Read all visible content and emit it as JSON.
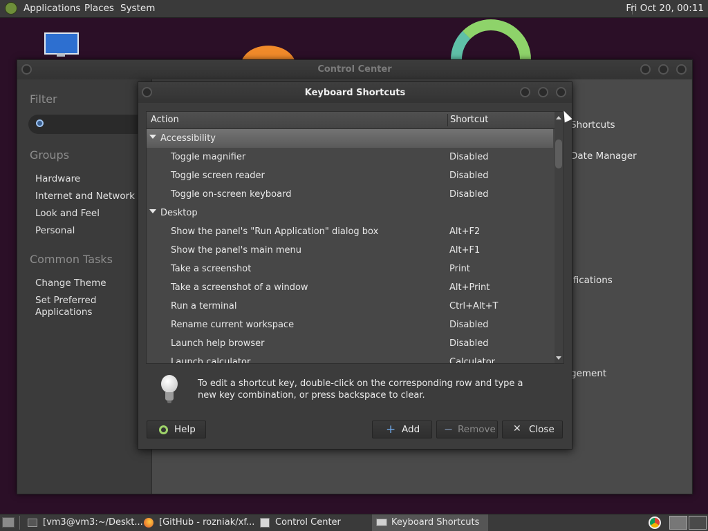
{
  "top_panel": {
    "menus": [
      "Applications",
      "Places",
      "System"
    ],
    "clock": "Fri Oct 20, 00:11"
  },
  "control_center": {
    "title": "Control Center",
    "filter_heading": "Filter",
    "groups_heading": "Groups",
    "groups": [
      "Hardware",
      "Internet and Network",
      "Look and Feel",
      "Personal"
    ],
    "tasks_heading": "Common Tasks",
    "tasks": [
      "Change Theme",
      "Set Preferred\nApplications"
    ],
    "peek_items": [
      "Shortcuts",
      "Date Manager",
      "ifications",
      "gement"
    ]
  },
  "dialog": {
    "title": "Keyboard Shortcuts",
    "columns": {
      "action": "Action",
      "shortcut": "Shortcut"
    },
    "rows": [
      {
        "type": "category",
        "action": "Accessibility",
        "shortcut": "",
        "selected": true
      },
      {
        "type": "item",
        "action": "Toggle magnifier",
        "shortcut": "Disabled"
      },
      {
        "type": "item",
        "action": "Toggle screen reader",
        "shortcut": "Disabled"
      },
      {
        "type": "item",
        "action": "Toggle on-screen keyboard",
        "shortcut": "Disabled"
      },
      {
        "type": "category",
        "action": "Desktop",
        "shortcut": ""
      },
      {
        "type": "item",
        "action": "Show the panel's \"Run Application\" dialog box",
        "shortcut": "Alt+F2"
      },
      {
        "type": "item",
        "action": "Show the panel's main menu",
        "shortcut": "Alt+F1"
      },
      {
        "type": "item",
        "action": "Take a screenshot",
        "shortcut": "Print"
      },
      {
        "type": "item",
        "action": "Take a screenshot of a window",
        "shortcut": "Alt+Print"
      },
      {
        "type": "item",
        "action": "Run a terminal",
        "shortcut": "Ctrl+Alt+T"
      },
      {
        "type": "item",
        "action": "Rename current workspace",
        "shortcut": "Disabled"
      },
      {
        "type": "item",
        "action": "Launch help browser",
        "shortcut": "Disabled"
      },
      {
        "type": "item",
        "action": "Launch calculator",
        "shortcut": "Calculator"
      }
    ],
    "hint": "To edit a shortcut key, double-click on the corresponding row and type a new key combination, or press backspace to clear.",
    "buttons": {
      "help": "Help",
      "add": "Add",
      "remove": "Remove",
      "close": "Close"
    }
  },
  "taskbar": {
    "tasks": [
      "[vm3@vm3:~/Deskt...",
      "[GitHub - rozniak/xf...",
      "Control Center",
      "Keyboard Shortcuts"
    ]
  },
  "colors": {
    "panel": "#3a3a3a",
    "desktop": "#2b0f27",
    "selection": "#6a6a6a"
  }
}
